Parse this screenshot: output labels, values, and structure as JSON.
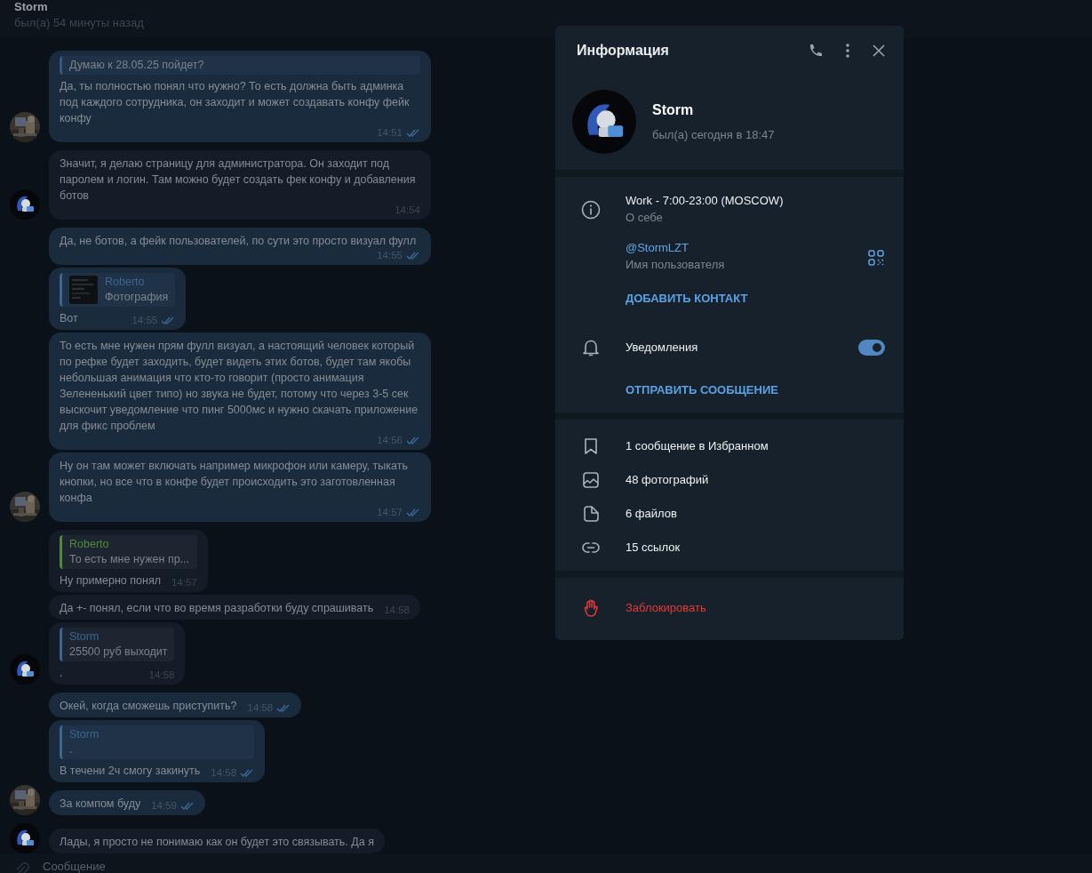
{
  "chat_header": {
    "title": "Storm",
    "status": "был(а) 54 минуты назад"
  },
  "messages": [
    {
      "kind": "outgoing",
      "avatar": true,
      "reply": {
        "text": "Думаю к 28.05.25 пойдет?"
      },
      "text": "Да, ты полностью понял что нужно? То есть должна быть админка под каждого сотрудника, он заходит и может создавать конфу фейк конфу",
      "time": "14:51",
      "read": true
    },
    {
      "kind": "incoming",
      "avatar": true,
      "text": "Значит, я делаю страницу для администратора. Он заходит под паролем и логин. Там можно будет создать фек конфу и добавления ботов",
      "time": "14:54"
    },
    {
      "kind": "outgoing",
      "text": "Да, не ботов, а фейк пользователей, по сути это просто визуал фулл",
      "time": "14:55",
      "read": true
    },
    {
      "kind": "outgoing",
      "reply": {
        "author": "Roberto",
        "color": "#3a6690",
        "text": "Фотография",
        "thumbnail": true
      },
      "text": "Вот",
      "time": "14:55",
      "read": true
    },
    {
      "kind": "outgoing",
      "text": "То есть мне нужен прям фулл визуал, а настоящий человек который по рефке будет заходить, будет видеть этих ботов, будет там якобы небольшая анимация что кто-то говорит (просто анимация Зелененький цвет типо) но звука не будет, потому что через 3-5 сек выскочит уведомление что пинг 5000мс и нужно скачать приложение для фикс проблем",
      "time": "14:56",
      "read": true
    },
    {
      "kind": "outgoing",
      "avatar": true,
      "text": "Ну он там может включать например микрофон или камеру, тыкать кнопки, но все что в конфе будет происходить это заготовленная конфа",
      "time": "14:57",
      "read": true
    },
    {
      "kind": "incoming",
      "reply": {
        "author": "Roberto",
        "color": "#4f8a3a",
        "text": "То есть мне нужен пр..."
      },
      "text": "Ну примерно понял",
      "time": "14:57"
    },
    {
      "kind": "incoming",
      "text": "Да +- понял, если что во время разработки буду спрашивать",
      "time": "14:58"
    },
    {
      "kind": "incoming",
      "avatar": true,
      "reply": {
        "author": "Storm",
        "color": "#3a6690",
        "text": "25500 руб выходит"
      },
      "text": ".",
      "time": "14:58"
    },
    {
      "kind": "outgoing",
      "text": "Окей, когда сможешь приступить?",
      "time": "14:58",
      "read": true
    },
    {
      "kind": "outgoing",
      "reply": {
        "author": "Storm",
        "color": "#3a6690",
        "text": "."
      },
      "text": "В течени 2ч смогу закинуть",
      "time": "14:58",
      "read": true
    },
    {
      "kind": "outgoing",
      "avatar": true,
      "text": "За компом буду",
      "time": "14:59",
      "read": true
    },
    {
      "kind": "incoming",
      "avatar": true,
      "text": "Лады, я просто не понимаю как он будет это связывать. Да я"
    }
  ],
  "composer": {
    "placeholder": "Сообщение"
  },
  "info_panel": {
    "title": "Информация",
    "profile": {
      "name": "Storm",
      "status": "был(а) сегодня в 18:47"
    },
    "bio": {
      "value": "Work - 7:00-23:00 (MOSCOW)",
      "label": "О себе"
    },
    "username": {
      "value": "@StormLZT",
      "label": "Имя пользователя"
    },
    "add_contact": "ДОБАВИТЬ КОНТАКТ",
    "notifications": {
      "label": "Уведомления",
      "on": true
    },
    "send_message": "ОТПРАВИТЬ СООБЩЕНИЕ",
    "media": [
      {
        "kind": "saved",
        "label": "1 сообщение в Избранном"
      },
      {
        "kind": "photos",
        "label": "48 фотографий"
      },
      {
        "kind": "files",
        "label": "6 файлов"
      },
      {
        "kind": "links",
        "label": "15 ссылок"
      }
    ],
    "block": "Заблокировать"
  }
}
